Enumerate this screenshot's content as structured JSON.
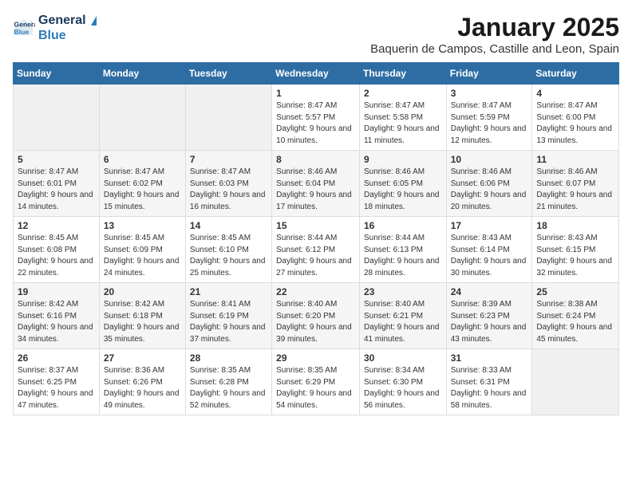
{
  "logo": {
    "line1": "General",
    "line2": "Blue"
  },
  "title": "January 2025",
  "location": "Baquerin de Campos, Castille and Leon, Spain",
  "weekdays": [
    "Sunday",
    "Monday",
    "Tuesday",
    "Wednesday",
    "Thursday",
    "Friday",
    "Saturday"
  ],
  "weeks": [
    [
      {
        "day": "",
        "sunrise": "",
        "sunset": "",
        "daylight": ""
      },
      {
        "day": "",
        "sunrise": "",
        "sunset": "",
        "daylight": ""
      },
      {
        "day": "",
        "sunrise": "",
        "sunset": "",
        "daylight": ""
      },
      {
        "day": "1",
        "sunrise": "Sunrise: 8:47 AM",
        "sunset": "Sunset: 5:57 PM",
        "daylight": "Daylight: 9 hours and 10 minutes."
      },
      {
        "day": "2",
        "sunrise": "Sunrise: 8:47 AM",
        "sunset": "Sunset: 5:58 PM",
        "daylight": "Daylight: 9 hours and 11 minutes."
      },
      {
        "day": "3",
        "sunrise": "Sunrise: 8:47 AM",
        "sunset": "Sunset: 5:59 PM",
        "daylight": "Daylight: 9 hours and 12 minutes."
      },
      {
        "day": "4",
        "sunrise": "Sunrise: 8:47 AM",
        "sunset": "Sunset: 6:00 PM",
        "daylight": "Daylight: 9 hours and 13 minutes."
      }
    ],
    [
      {
        "day": "5",
        "sunrise": "Sunrise: 8:47 AM",
        "sunset": "Sunset: 6:01 PM",
        "daylight": "Daylight: 9 hours and 14 minutes."
      },
      {
        "day": "6",
        "sunrise": "Sunrise: 8:47 AM",
        "sunset": "Sunset: 6:02 PM",
        "daylight": "Daylight: 9 hours and 15 minutes."
      },
      {
        "day": "7",
        "sunrise": "Sunrise: 8:47 AM",
        "sunset": "Sunset: 6:03 PM",
        "daylight": "Daylight: 9 hours and 16 minutes."
      },
      {
        "day": "8",
        "sunrise": "Sunrise: 8:46 AM",
        "sunset": "Sunset: 6:04 PM",
        "daylight": "Daylight: 9 hours and 17 minutes."
      },
      {
        "day": "9",
        "sunrise": "Sunrise: 8:46 AM",
        "sunset": "Sunset: 6:05 PM",
        "daylight": "Daylight: 9 hours and 18 minutes."
      },
      {
        "day": "10",
        "sunrise": "Sunrise: 8:46 AM",
        "sunset": "Sunset: 6:06 PM",
        "daylight": "Daylight: 9 hours and 20 minutes."
      },
      {
        "day": "11",
        "sunrise": "Sunrise: 8:46 AM",
        "sunset": "Sunset: 6:07 PM",
        "daylight": "Daylight: 9 hours and 21 minutes."
      }
    ],
    [
      {
        "day": "12",
        "sunrise": "Sunrise: 8:45 AM",
        "sunset": "Sunset: 6:08 PM",
        "daylight": "Daylight: 9 hours and 22 minutes."
      },
      {
        "day": "13",
        "sunrise": "Sunrise: 8:45 AM",
        "sunset": "Sunset: 6:09 PM",
        "daylight": "Daylight: 9 hours and 24 minutes."
      },
      {
        "day": "14",
        "sunrise": "Sunrise: 8:45 AM",
        "sunset": "Sunset: 6:10 PM",
        "daylight": "Daylight: 9 hours and 25 minutes."
      },
      {
        "day": "15",
        "sunrise": "Sunrise: 8:44 AM",
        "sunset": "Sunset: 6:12 PM",
        "daylight": "Daylight: 9 hours and 27 minutes."
      },
      {
        "day": "16",
        "sunrise": "Sunrise: 8:44 AM",
        "sunset": "Sunset: 6:13 PM",
        "daylight": "Daylight: 9 hours and 28 minutes."
      },
      {
        "day": "17",
        "sunrise": "Sunrise: 8:43 AM",
        "sunset": "Sunset: 6:14 PM",
        "daylight": "Daylight: 9 hours and 30 minutes."
      },
      {
        "day": "18",
        "sunrise": "Sunrise: 8:43 AM",
        "sunset": "Sunset: 6:15 PM",
        "daylight": "Daylight: 9 hours and 32 minutes."
      }
    ],
    [
      {
        "day": "19",
        "sunrise": "Sunrise: 8:42 AM",
        "sunset": "Sunset: 6:16 PM",
        "daylight": "Daylight: 9 hours and 34 minutes."
      },
      {
        "day": "20",
        "sunrise": "Sunrise: 8:42 AM",
        "sunset": "Sunset: 6:18 PM",
        "daylight": "Daylight: 9 hours and 35 minutes."
      },
      {
        "day": "21",
        "sunrise": "Sunrise: 8:41 AM",
        "sunset": "Sunset: 6:19 PM",
        "daylight": "Daylight: 9 hours and 37 minutes."
      },
      {
        "day": "22",
        "sunrise": "Sunrise: 8:40 AM",
        "sunset": "Sunset: 6:20 PM",
        "daylight": "Daylight: 9 hours and 39 minutes."
      },
      {
        "day": "23",
        "sunrise": "Sunrise: 8:40 AM",
        "sunset": "Sunset: 6:21 PM",
        "daylight": "Daylight: 9 hours and 41 minutes."
      },
      {
        "day": "24",
        "sunrise": "Sunrise: 8:39 AM",
        "sunset": "Sunset: 6:23 PM",
        "daylight": "Daylight: 9 hours and 43 minutes."
      },
      {
        "day": "25",
        "sunrise": "Sunrise: 8:38 AM",
        "sunset": "Sunset: 6:24 PM",
        "daylight": "Daylight: 9 hours and 45 minutes."
      }
    ],
    [
      {
        "day": "26",
        "sunrise": "Sunrise: 8:37 AM",
        "sunset": "Sunset: 6:25 PM",
        "daylight": "Daylight: 9 hours and 47 minutes."
      },
      {
        "day": "27",
        "sunrise": "Sunrise: 8:36 AM",
        "sunset": "Sunset: 6:26 PM",
        "daylight": "Daylight: 9 hours and 49 minutes."
      },
      {
        "day": "28",
        "sunrise": "Sunrise: 8:35 AM",
        "sunset": "Sunset: 6:28 PM",
        "daylight": "Daylight: 9 hours and 52 minutes."
      },
      {
        "day": "29",
        "sunrise": "Sunrise: 8:35 AM",
        "sunset": "Sunset: 6:29 PM",
        "daylight": "Daylight: 9 hours and 54 minutes."
      },
      {
        "day": "30",
        "sunrise": "Sunrise: 8:34 AM",
        "sunset": "Sunset: 6:30 PM",
        "daylight": "Daylight: 9 hours and 56 minutes."
      },
      {
        "day": "31",
        "sunrise": "Sunrise: 8:33 AM",
        "sunset": "Sunset: 6:31 PM",
        "daylight": "Daylight: 9 hours and 58 minutes."
      },
      {
        "day": "",
        "sunrise": "",
        "sunset": "",
        "daylight": ""
      }
    ]
  ]
}
